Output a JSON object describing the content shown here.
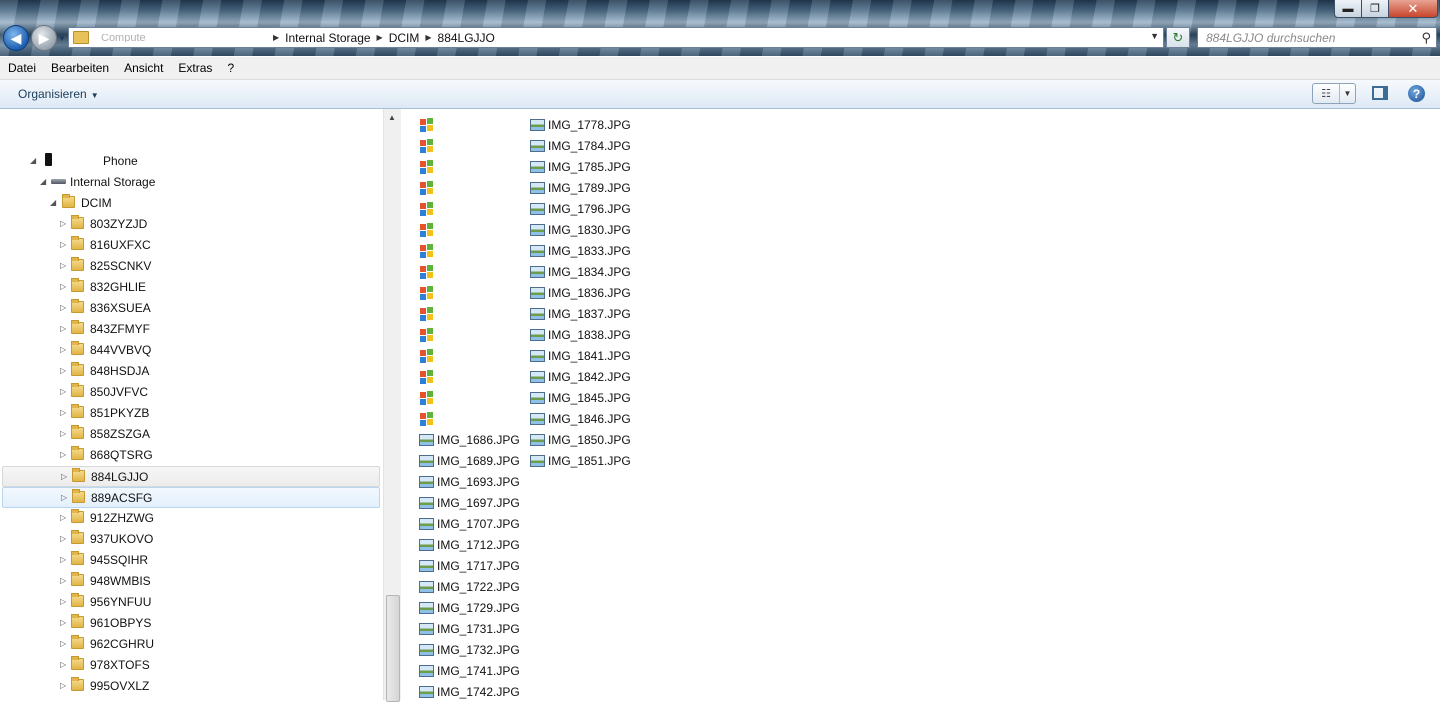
{
  "window": {
    "controls": {
      "minimize": "▬",
      "maximize": "❐",
      "close": "✕"
    }
  },
  "address": {
    "hidden_prefix": "Compute",
    "crumbs": [
      "Internal Storage",
      "DCIM",
      "884LGJJO"
    ],
    "search_placeholder": "884LGJJO durchsuchen"
  },
  "menu": [
    "Datei",
    "Bearbeiten",
    "Ansicht",
    "Extras",
    "?"
  ],
  "toolbar": {
    "organize_label": "Organisieren"
  },
  "tree": {
    "phone_label": "Phone",
    "storage_label": "Internal Storage",
    "dcim_label": "DCIM",
    "folders": [
      "803ZYZJD",
      "816UXFXC",
      "825SCNKV",
      "832GHLIE",
      "836XSUEA",
      "843ZFMYF",
      "844VVBVQ",
      "848HSDJA",
      "850JVFVC",
      "851PKYZB",
      "858ZSZGA",
      "868QTSRG",
      "884LGJJO",
      "889ACSFG",
      "912ZHZWG",
      "937UKOVO",
      "945SQIHR",
      "948WMBIS",
      "956YNFUU",
      "961OBPYS",
      "962CGHRU",
      "978XTOFS",
      "995OVXLZ"
    ],
    "hovered_folder": "884LGJJO",
    "selected_folder": "889ACSFG"
  },
  "files": {
    "column1_unnamed_count": 15,
    "column1": [
      "IMG_1686.JPG",
      "IMG_1689.JPG",
      "IMG_1693.JPG",
      "IMG_1697.JPG",
      "IMG_1707.JPG",
      "IMG_1712.JPG",
      "IMG_1717.JPG",
      "IMG_1722.JPG",
      "IMG_1729.JPG",
      "IMG_1731.JPG",
      "IMG_1732.JPG",
      "IMG_1741.JPG",
      "IMG_1742.JPG"
    ],
    "column2": [
      "IMG_1778.JPG",
      "IMG_1784.JPG",
      "IMG_1785.JPG",
      "IMG_1789.JPG",
      "IMG_1796.JPG",
      "IMG_1830.JPG",
      "IMG_1833.JPG",
      "IMG_1834.JPG",
      "IMG_1836.JPG",
      "IMG_1837.JPG",
      "IMG_1838.JPG",
      "IMG_1841.JPG",
      "IMG_1842.JPG",
      "IMG_1845.JPG",
      "IMG_1846.JPG",
      "IMG_1850.JPG",
      "IMG_1851.JPG"
    ]
  }
}
